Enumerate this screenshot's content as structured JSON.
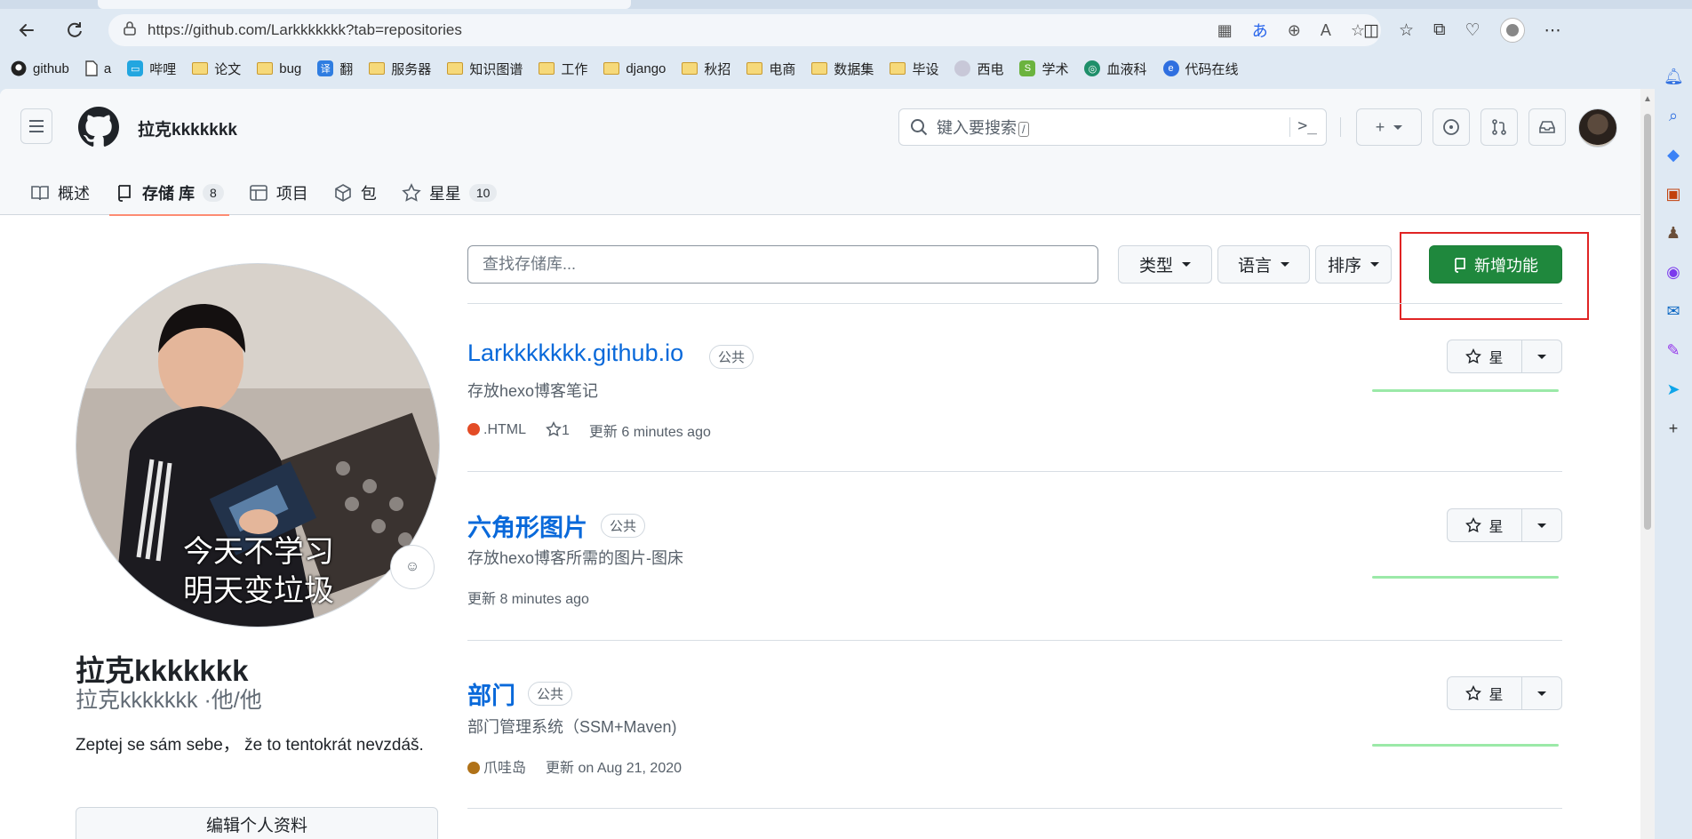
{
  "browser": {
    "url": "https://github.com/Larkkkkkkk?tab=repositories",
    "bookmarks": [
      "github",
      "a",
      "哔哩",
      "论文",
      "bug",
      "翻",
      "服务器",
      "知识图谱",
      "工作",
      "django",
      "秋招",
      "电商",
      "数据集",
      "毕设",
      "西电",
      "学术",
      "血液科",
      "代码在线"
    ]
  },
  "header": {
    "username": "拉克kkkkkkk",
    "search_placeholder": "键入要搜索",
    "search_slash": "/",
    "terminal": ">_"
  },
  "tabs": [
    {
      "label": "概述"
    },
    {
      "label": "存储 库",
      "count": "8"
    },
    {
      "label": "项目"
    },
    {
      "label": "包"
    },
    {
      "label": "星星",
      "count": "10"
    }
  ],
  "profile": {
    "name": "拉克kkkkkkk",
    "login": "拉克kkkkkkk ·他/他",
    "bio": "Zeptej se sám sebe， že to tentokrát nevzdáš.",
    "avatar_caption_1": "今天不学习",
    "avatar_caption_2": "明天变垃圾",
    "edit_label": "编辑个人资料"
  },
  "filters": {
    "find_placeholder": "查找存储库...",
    "type_label": "类型",
    "language_label": "语言",
    "sort_label": "排序",
    "new_label": "新增功能"
  },
  "repos": [
    {
      "name": "Larkkkkkkk.github.io",
      "visibility": "公共",
      "description": "存放hexo博客笔记",
      "language": ".HTML",
      "language_color": "#e34c26",
      "stars": "1",
      "updated": "更新 6 minutes ago"
    },
    {
      "name": "六角形图片",
      "visibility": "公共",
      "description": "存放hexo博客所需的图片-图床",
      "updated": "更新 8 minutes ago"
    },
    {
      "name": "部门",
      "visibility": "公共",
      "description": "部门管理系统（SSM+Maven)",
      "language": "爪哇岛",
      "language_color": "#b07219",
      "updated": "更新 on Aug 21, 2020"
    }
  ],
  "star_label": "星"
}
